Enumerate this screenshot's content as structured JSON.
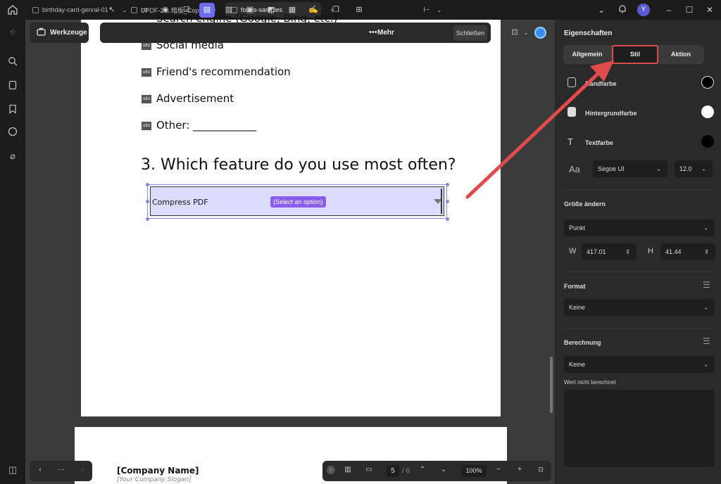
{
  "tabs": [
    {
      "label": "birthday-card-genral-01"
    },
    {
      "label": "UPDF-2-...暗版_Copy"
    },
    {
      "label": "forms-samples"
    }
  ],
  "user": {
    "avatar_letter": "Y"
  },
  "toolbar": {
    "werkzeuge_label": "Werkzeuge",
    "mehr_label": "Mehr",
    "close_label": "Schließen"
  },
  "document": {
    "partial_line": "Search engine (Google, Bing, etc.)",
    "checkbox_glyph": "utto",
    "options": [
      "Social media",
      "Friend's recommendation",
      "Advertisement",
      "Other: ____________"
    ],
    "question": "3. Which feature do you use most often?",
    "dropdown_value": "Compress PDF",
    "dropdown_placeholder": "(Select an option)",
    "company_name": "[Company Name]",
    "company_slogan": "[Your Company Slogan]"
  },
  "panel": {
    "title": "Eigenschaften",
    "tabs": [
      "Allgemein",
      "Stil",
      "Aktion"
    ],
    "active_tab": "Stil",
    "border_color_label": "Randfarbe",
    "bg_color_label": "Hintergrundfarbe",
    "text_color_label": "Textfarbe",
    "font_family": "Segoe UI",
    "font_size": "12.0",
    "size_section": "Größe ändern",
    "size_unit": "Punkt",
    "w_label": "W",
    "w_value": "417.01",
    "h_label": "H",
    "h_value": "41.44",
    "format_section": "Format",
    "format_value": "Keine",
    "calc_section": "Berechnung",
    "calc_value": "Keine",
    "calc_note": "Wert nicht berechnet"
  },
  "colors": {
    "border_swatch": "#000000",
    "bg_swatch": "#ffffff",
    "text_swatch": "#000000",
    "accent": "#6c6cf0",
    "highlight": "#e14b4b"
  },
  "nav": {
    "page_current": "5",
    "page_total": "/ 6",
    "zoom": "100%"
  }
}
